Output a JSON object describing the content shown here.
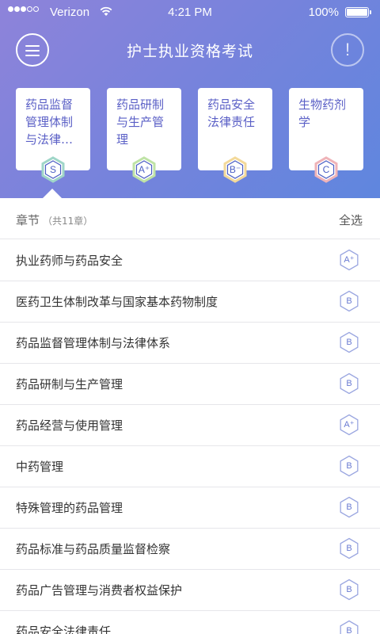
{
  "status_bar": {
    "carrier": "Verizon",
    "time": "4:21 PM",
    "battery": "100%"
  },
  "header": {
    "title": "护士执业资格考试",
    "info_symbol": "!"
  },
  "cards": [
    {
      "title": "药品监督管理体制与法律…",
      "grade": "S",
      "ring": "#9fd6c8"
    },
    {
      "title": "药品研制与生产管理",
      "grade": "A⁺",
      "ring": "#bfe3a6"
    },
    {
      "title": "药品安全法律责任",
      "grade": "B⁻",
      "ring": "#f3d99a"
    },
    {
      "title": "生物药剂学",
      "grade": "C",
      "ring": "#efb3b8"
    }
  ],
  "section": {
    "title": "章节",
    "count": "（共11章）",
    "select_all": "全选"
  },
  "chapters": [
    {
      "title": "执业药师与药品安全",
      "grade": "A⁺"
    },
    {
      "title": "医药卫生体制改革与国家基本药物制度",
      "grade": "B"
    },
    {
      "title": "药品监督管理体制与法律体系",
      "grade": "B"
    },
    {
      "title": "药品研制与生产管理",
      "grade": "B"
    },
    {
      "title": "药品经营与使用管理",
      "grade": "A⁺"
    },
    {
      "title": "中药管理",
      "grade": "B"
    },
    {
      "title": "特殊管理的药品管理",
      "grade": "B"
    },
    {
      "title": "药品标准与药品质量监督检察",
      "grade": "B"
    },
    {
      "title": "药品广告管理与消费者权益保护",
      "grade": "B"
    },
    {
      "title": "药品安全法律责任",
      "grade": "B"
    }
  ],
  "colors": {
    "header_gradient_start": "#8e83da",
    "header_gradient_end": "#5f86de",
    "accent": "#5a5fc6",
    "badge_stroke": "#9aa6e0"
  }
}
